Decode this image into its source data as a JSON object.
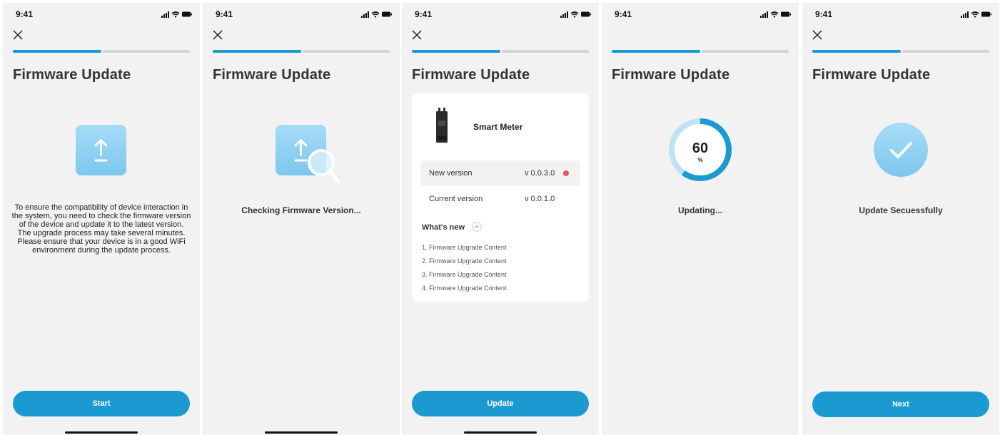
{
  "screens": [
    {
      "time": "9:41",
      "title": "Firmware Update",
      "body": "To ensure the compatibility of device interaction in the system, you need to check the firmware version of the device and update it to the latest version.\nThe upgrade process may take several minutes. Please ensure that your device is in a good WiFi environment during the update process.",
      "button_label": "Start"
    },
    {
      "time": "9:41",
      "title": "Firmware Update",
      "status": "Checking Firmware Version..."
    },
    {
      "time": "9:41",
      "title": "Firmware Update",
      "device_name": "Smart Meter",
      "new_version_label": "New version",
      "new_version_value": "v 0.0.3.0",
      "current_version_label": "Current version",
      "current_version_value": "v 0.0.1.0",
      "whats_new_label": "What's new",
      "notes": [
        "1. Firmware Upgrade Content",
        "2. Firmware Upgrade Content",
        "3. Firmware Upgrade Content",
        "4. Firmware Upgrade Content"
      ],
      "button_label": "Update"
    },
    {
      "time": "9:41",
      "title": "Firmware Update",
      "progress_value": "60",
      "progress_unit": "%",
      "progress_fraction": 0.6,
      "status": "Updating..."
    },
    {
      "time": "9:41",
      "title": "Firmware Update",
      "status": "Update Secuessfully",
      "button_label": "Next"
    }
  ],
  "colors": {
    "accent": "#1b9ad1",
    "progress_track": "#d4d4d4",
    "new_version_dot": "#e45a5a",
    "screen_bg": "#f2f2f2"
  },
  "icons": [
    "close-icon",
    "upload-icon",
    "search-icon",
    "check-icon",
    "signal-icon",
    "wifi-icon",
    "battery-icon",
    "chevron-up-icon"
  ]
}
